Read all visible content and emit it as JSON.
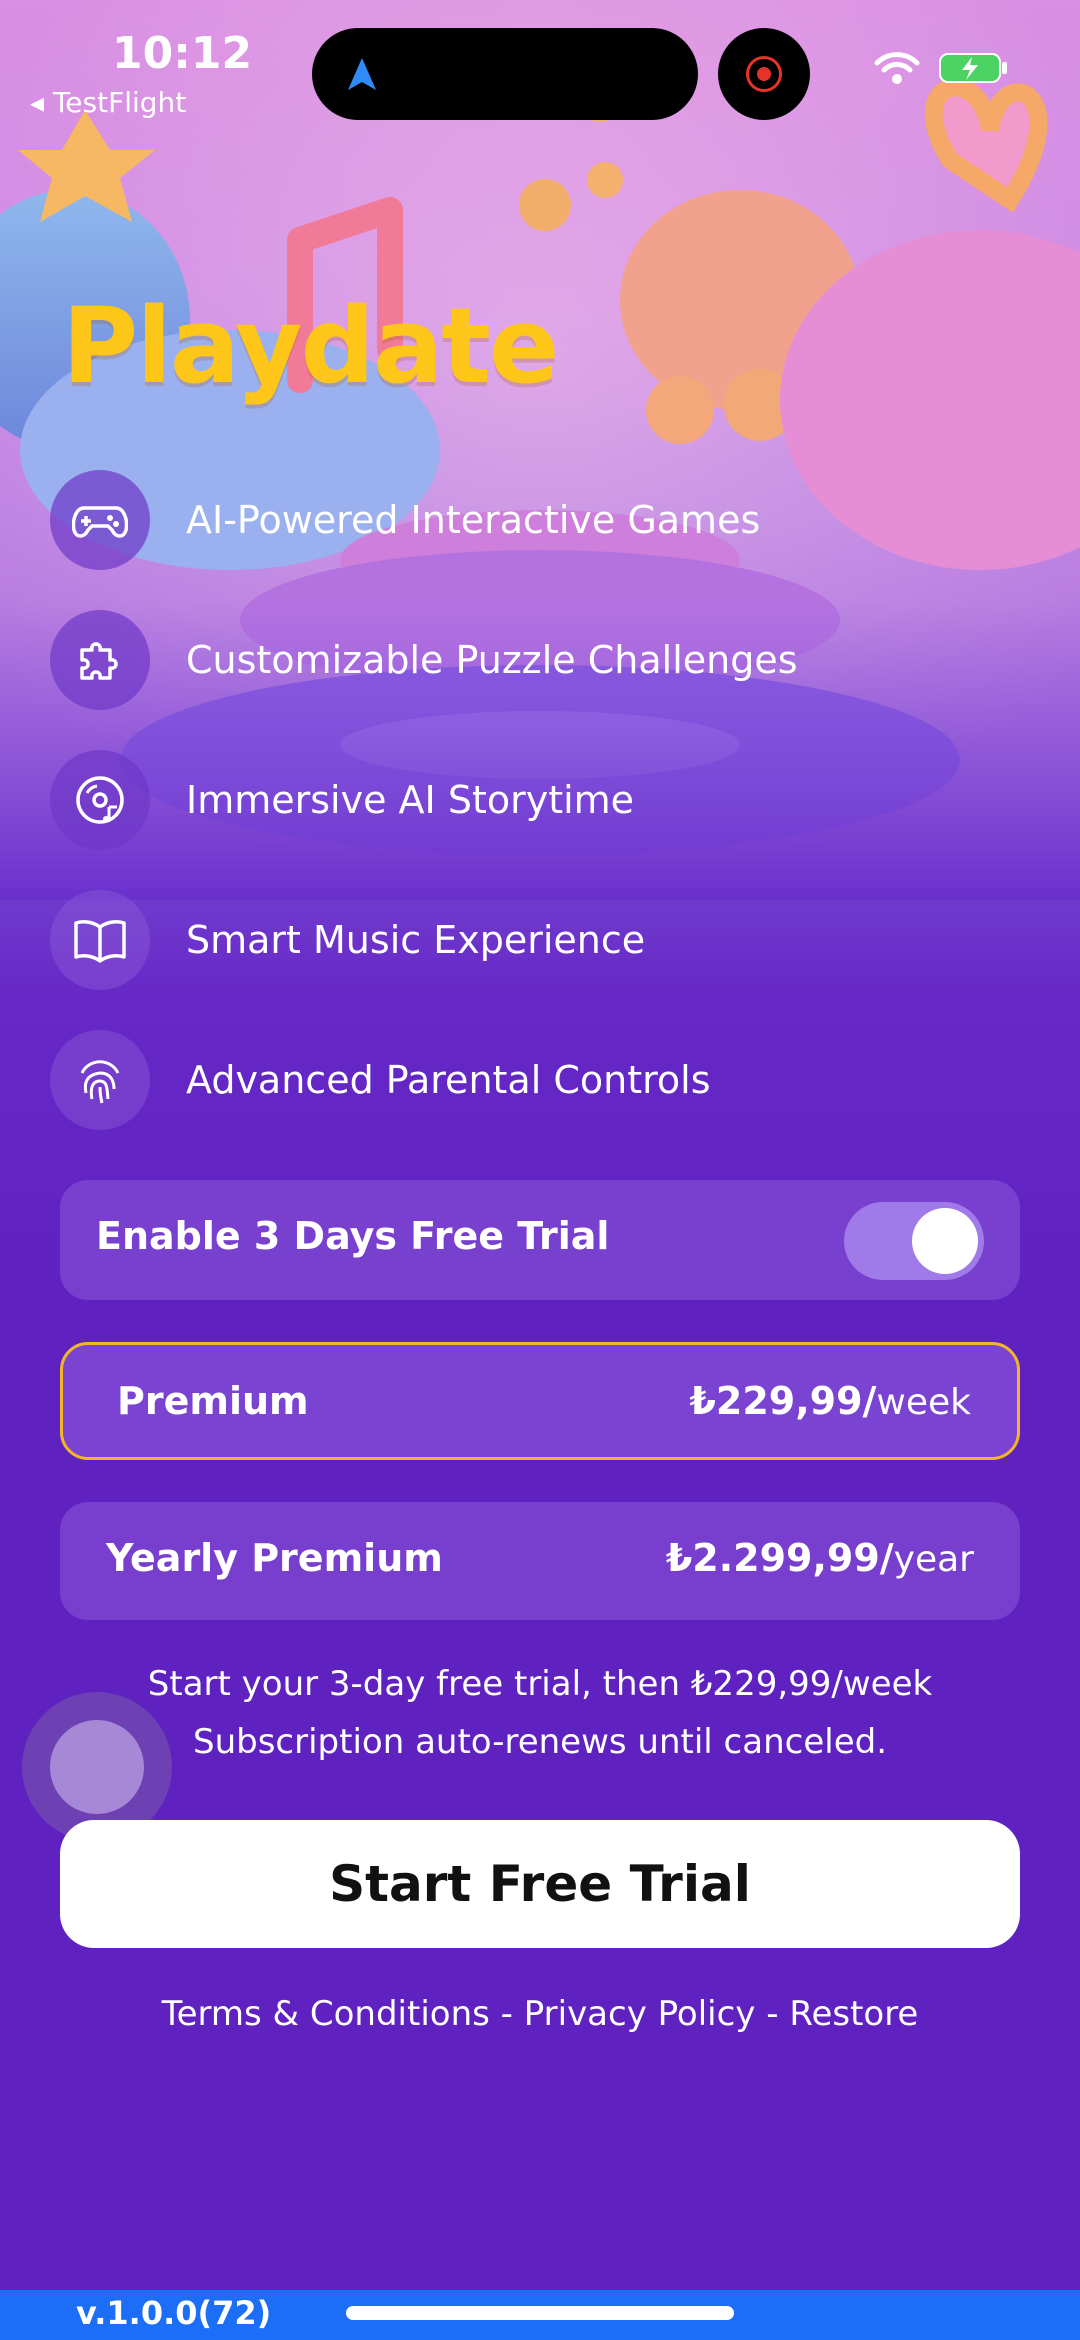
{
  "status_bar": {
    "time": "10:12",
    "back_app": "◂ TestFlight",
    "icons": [
      "location-arrow-icon",
      "record-icon",
      "wifi-icon",
      "battery-charging-icon"
    ]
  },
  "app": {
    "title": "Playdate"
  },
  "features": [
    {
      "icon": "gamepad-icon",
      "label": "AI-Powered Interactive Games"
    },
    {
      "icon": "puzzle-icon",
      "label": "Customizable Puzzle Challenges"
    },
    {
      "icon": "music-disc-icon",
      "label": "Immersive AI Storytime"
    },
    {
      "icon": "book-icon",
      "label": "Smart Music Experience"
    },
    {
      "icon": "fingerprint-icon",
      "label": "Advanced Parental Controls"
    }
  ],
  "trial_toggle": {
    "label": "Enable 3 Days Free Trial",
    "enabled": true
  },
  "plans": [
    {
      "name": "Premium",
      "price": "₺229,99/",
      "unit": "week",
      "selected": true
    },
    {
      "name": "Yearly Premium",
      "price": "₺2.299,99/",
      "unit": "year",
      "selected": false
    }
  ],
  "disclaimer": {
    "line1": "Start your 3-day free trial, then ₺229,99/week",
    "line2": "Subscription auto-renews until canceled."
  },
  "cta": {
    "label": "Start Free Trial"
  },
  "footer_links": {
    "terms": "Terms & Conditions",
    "sep1": " - ",
    "privacy": "Privacy Policy",
    "sep2": " - ",
    "restore": "Restore"
  },
  "version": "v.1.0.0(72)",
  "colors": {
    "title": "#ffc61a",
    "background": "#5f22c0",
    "selected_border": "#f3b62b",
    "toggle_on": "#9f7ae8"
  }
}
